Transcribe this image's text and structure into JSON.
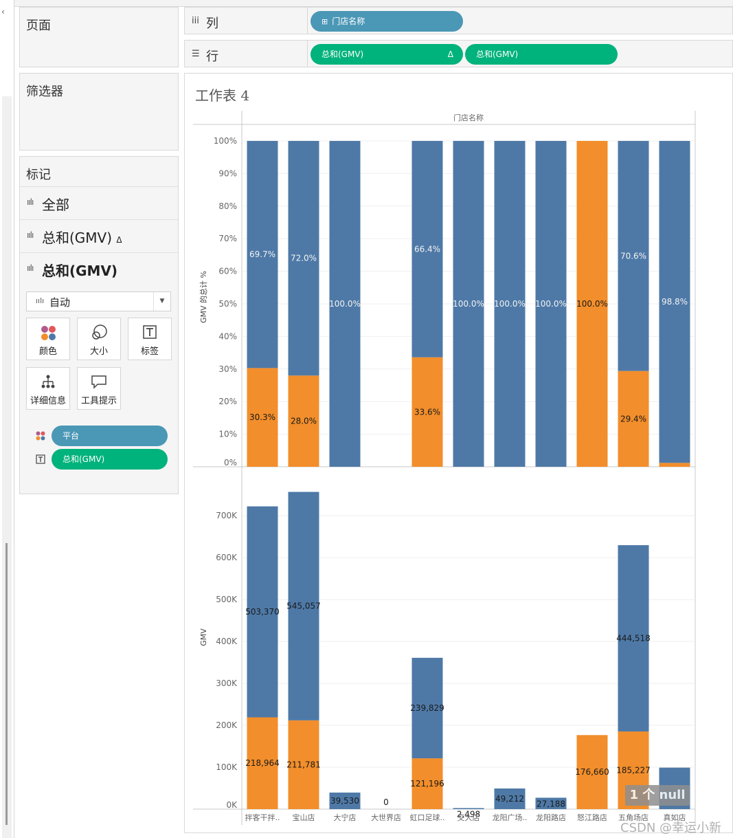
{
  "panels": {
    "pages": "页面",
    "filters": "筛选器",
    "marks": "标记"
  },
  "marks": {
    "rows": [
      "全部",
      "总和(GMV)",
      "总和(GMV)"
    ],
    "row_delta": "Δ",
    "type": "自动",
    "buttons": {
      "color": "颜色",
      "size": "大小",
      "label": "标签",
      "detail": "详细信息",
      "tooltip": "工具提示"
    },
    "pills": [
      "平台",
      "总和(GMV)"
    ]
  },
  "shelves": {
    "columns_label": "列",
    "rows_label": "行",
    "column_pill": "门店名称",
    "row_pills": [
      "总和(GMV)",
      "总和(GMV)"
    ],
    "row_pill_delta": "Δ"
  },
  "sheet": {
    "title": "工作表 4"
  },
  "watermark": "CSDN @幸运小新",
  "null_badge": "1 个 null",
  "colors": {
    "blue": "#4e79a7",
    "orange": "#f28e2b",
    "pill_blue": "#4b97b6",
    "pill_green": "#00b27b"
  },
  "chart_data": {
    "type": "bar",
    "header": "门店名称",
    "categories": [
      "拌客干拌..",
      "宝山店",
      "大宁店",
      "大世界店",
      "虹口足球..",
      "交大店",
      "龙阳广场..",
      "龙阳路店",
      "怒江路店",
      "五角场店",
      "真如店"
    ],
    "top": {
      "ylabel": "GMV 的总计 %",
      "ylim": [
        0,
        100
      ],
      "ticks": [
        "0%",
        "10%",
        "20%",
        "30%",
        "40%",
        "50%",
        "60%",
        "70%",
        "80%",
        "90%",
        "100%"
      ],
      "series": [
        {
          "color": "orange",
          "values": [
            30.3,
            28.0,
            0,
            null,
            33.6,
            0,
            0,
            0,
            100.0,
            29.4,
            1.2
          ],
          "labels": [
            "30.3%",
            "28.0%",
            "",
            "",
            "33.6%",
            "",
            "",
            "",
            "100.0%",
            "29.4%",
            ""
          ]
        },
        {
          "color": "blue",
          "values": [
            69.7,
            72.0,
            100.0,
            null,
            66.4,
            100.0,
            100.0,
            100.0,
            0,
            70.6,
            98.8
          ],
          "labels": [
            "69.7%",
            "72.0%",
            "100.0%",
            "",
            "66.4%",
            "100.0%",
            "100.0%",
            "100.0%",
            "",
            "70.6%",
            "98.8%"
          ]
        }
      ]
    },
    "bottom": {
      "ylabel": "GMV",
      "ylim": [
        0,
        720000
      ],
      "ticks": [
        "0K",
        "100K",
        "200K",
        "300K",
        "400K",
        "500K",
        "600K",
        "700K"
      ],
      "series": [
        {
          "color": "orange",
          "values": [
            218964,
            211781,
            0,
            0,
            121196,
            0,
            0,
            0,
            176660,
            185227,
            0
          ],
          "labels": [
            "218,964",
            "211,781",
            "",
            "0",
            "121,196",
            "",
            "",
            "",
            "176,660",
            "185,227",
            ""
          ]
        },
        {
          "color": "blue",
          "values": [
            503370,
            545057,
            39530,
            0,
            239829,
            2498,
            49212,
            27188,
            0,
            444518,
            99000
          ],
          "labels": [
            "503,370",
            "545,057",
            "39,530",
            "",
            "239,829",
            "2,498",
            "49,212",
            "27,188",
            "",
            "444,518",
            ""
          ]
        }
      ]
    }
  }
}
